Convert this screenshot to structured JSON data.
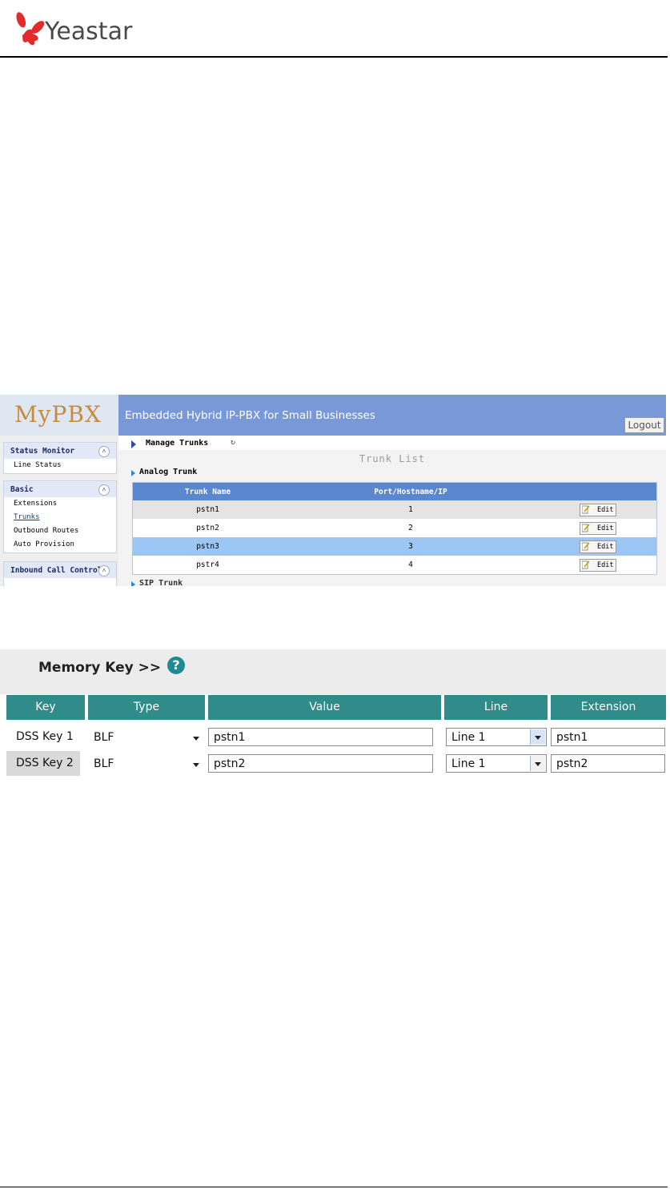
{
  "document": {
    "brand": "Yeastar"
  },
  "mypbx": {
    "brand": "MyPBX",
    "banner_title": "Embedded Hybrid IP-PBX for Small Businesses",
    "logout_label": "Logout",
    "sidebar": {
      "groups": [
        {
          "title": "Status Monitor",
          "items": [
            "Line Status"
          ]
        },
        {
          "title": "Basic",
          "items": [
            "Extensions",
            "Trunks",
            "Outbound Routes",
            "Auto Provision"
          ]
        },
        {
          "title": "Inbound Call Control",
          "items": []
        }
      ]
    },
    "breadcrumb": "Manage Trunks",
    "trunk_list_title": "Trunk List",
    "analog_trunk_label": "Analog Trunk",
    "sip_trunk_label": "SIP Trunk",
    "table": {
      "headers": [
        "Trunk Name",
        "Port/Hostname/IP",
        ""
      ],
      "rows": [
        {
          "name": "pstn1",
          "port": "1",
          "action": "Edit"
        },
        {
          "name": "pstn2",
          "port": "2",
          "action": "Edit"
        },
        {
          "name": "pstn3",
          "port": "3",
          "action": "Edit"
        },
        {
          "name": "pstr4",
          "port": "4",
          "action": "Edit"
        }
      ]
    }
  },
  "memory_key": {
    "title": "Memory Key >>",
    "help_icon": "?",
    "headers": [
      "Key",
      "Type",
      "Value",
      "Line",
      "Extension"
    ],
    "rows": [
      {
        "key": "DSS Key 1",
        "type": "BLF",
        "value": "pstn1",
        "line": "Line 1",
        "extension": "pstn1"
      },
      {
        "key": "DSS Key 2",
        "type": "BLF",
        "value": "pstn2",
        "line": "Line 1",
        "extension": "pstn2"
      }
    ]
  },
  "colors": {
    "pbx_banner": "#7898d8",
    "table_header": "#5b87d0",
    "selected_row": "#9cc6f4",
    "memory_key_header": "#2f8c8a"
  }
}
